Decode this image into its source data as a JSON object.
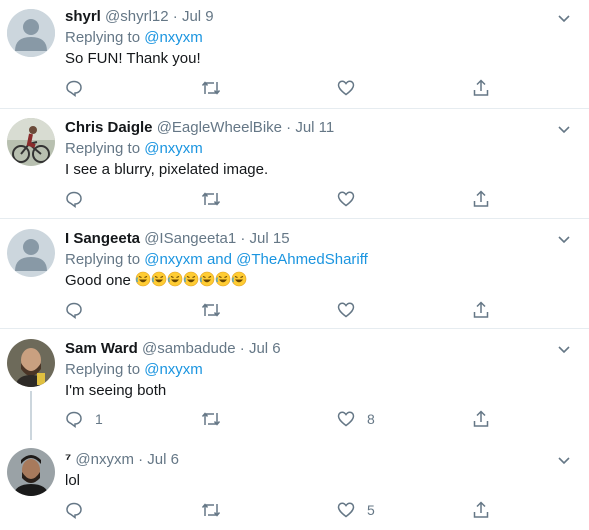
{
  "tweets": [
    {
      "name": "shyrl",
      "handle": "@shyrl12",
      "sep": "·",
      "date": "Jul 9",
      "replying_prefix": "Replying to",
      "replying_to": "@nxyxm",
      "text": "So FUN! Thank you!",
      "reply_count": "",
      "like_count": ""
    },
    {
      "name": "Chris Daigle",
      "handle": "@EagleWheelBike",
      "sep": "·",
      "date": "Jul 11",
      "replying_prefix": "Replying to",
      "replying_to": "@nxyxm",
      "text": "I see a blurry, pixelated image.",
      "reply_count": "",
      "like_count": ""
    },
    {
      "name": "I Sangeeta",
      "handle": "@ISangeeta1",
      "sep": "·",
      "date": "Jul 15",
      "replying_prefix": "Replying to",
      "replying_to": "@nxyxm and @TheAhmedShariff",
      "text": "Good one",
      "emoji": "rolling-on-floor-laughing",
      "emoji_count": 7,
      "reply_count": "",
      "like_count": ""
    },
    {
      "name": "Sam Ward",
      "handle": "@sambadude",
      "sep": "·",
      "date": "Jul 6",
      "replying_prefix": "Replying to",
      "replying_to": "@nxyxm",
      "text": "I'm seeing both",
      "reply_count": "1",
      "like_count": "8"
    },
    {
      "name": "⁷",
      "handle": "@nxyxm",
      "sep": "·",
      "date": "Jul 6",
      "text": "lol",
      "reply_count": "",
      "like_count": "5"
    }
  ],
  "colors": {
    "link": "#1b95e0",
    "muted": "#657786",
    "divider": "#e6ecf0"
  },
  "icons": [
    "reply-icon",
    "retweet-icon",
    "like-icon",
    "share-icon",
    "chevron-down-icon"
  ]
}
